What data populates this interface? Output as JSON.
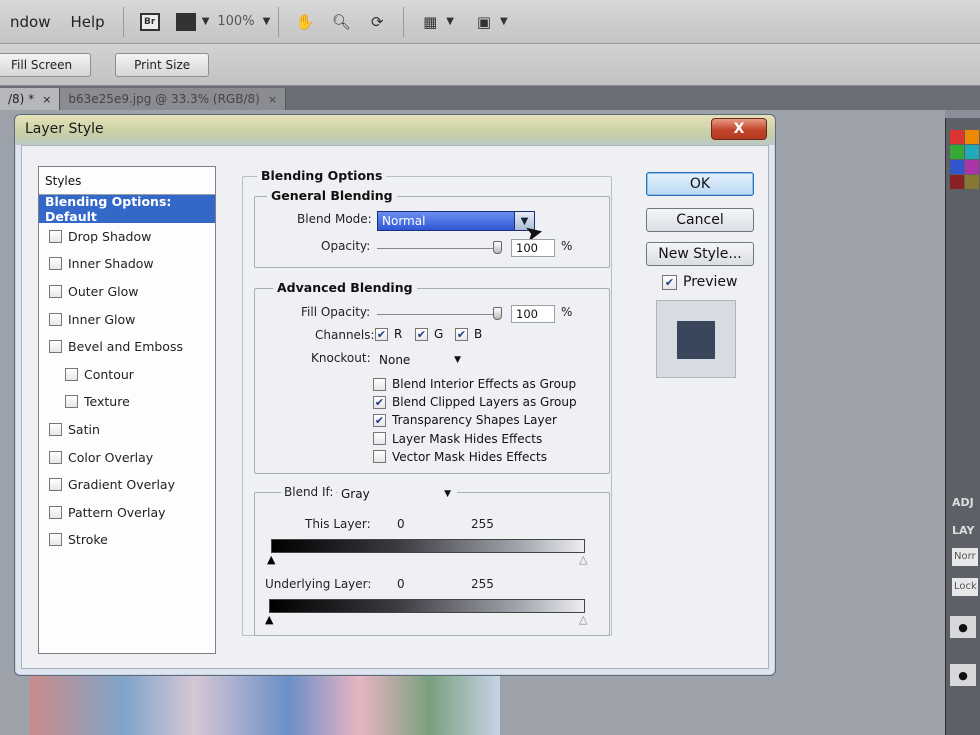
{
  "menubar": {
    "items": [
      "ndow",
      "Help"
    ],
    "zoom_level": "100%"
  },
  "optionsbar": {
    "fill_screen_label": "Fill Screen",
    "print_size_label": "Print Size"
  },
  "tabs": [
    {
      "label": "/8) *",
      "close": "×"
    },
    {
      "label": "b63e25e9.jpg @ 33.3% (RGB/8)",
      "close": "×"
    }
  ],
  "dialog": {
    "title": "Layer Style",
    "close_label": "X",
    "styles_list": {
      "header": "Styles",
      "items": [
        {
          "label": "Blending Options: Default",
          "selected": true,
          "checkbox": false,
          "checked": false
        },
        {
          "label": "Drop Shadow",
          "checkbox": true,
          "checked": false
        },
        {
          "label": "Inner Shadow",
          "checkbox": true,
          "checked": false
        },
        {
          "label": "Outer Glow",
          "checkbox": true,
          "checked": false
        },
        {
          "label": "Inner Glow",
          "checkbox": true,
          "checked": false
        },
        {
          "label": "Bevel and Emboss",
          "checkbox": true,
          "checked": false
        },
        {
          "label": "Contour",
          "checkbox": true,
          "checked": false,
          "sub": true
        },
        {
          "label": "Texture",
          "checkbox": true,
          "checked": false,
          "sub": true
        },
        {
          "label": "Satin",
          "checkbox": true,
          "checked": false
        },
        {
          "label": "Color Overlay",
          "checkbox": true,
          "checked": false
        },
        {
          "label": "Gradient Overlay",
          "checkbox": true,
          "checked": false
        },
        {
          "label": "Pattern Overlay",
          "checkbox": true,
          "checked": false
        },
        {
          "label": "Stroke",
          "checkbox": true,
          "checked": false
        }
      ]
    },
    "blending_options": {
      "title": "Blending Options",
      "general": {
        "title": "General Blending",
        "blend_mode_label": "Blend Mode:",
        "blend_mode_value": "Normal",
        "opacity_label": "Opacity:",
        "opacity_value": "100",
        "opacity_unit": "%"
      },
      "advanced": {
        "title": "Advanced Blending",
        "fill_opacity_label": "Fill Opacity:",
        "fill_opacity_value": "100",
        "fill_opacity_unit": "%",
        "channels_label": "Channels:",
        "channels": [
          {
            "label": "R",
            "checked": true
          },
          {
            "label": "G",
            "checked": true
          },
          {
            "label": "B",
            "checked": true
          }
        ],
        "knockout_label": "Knockout:",
        "knockout_value": "None",
        "options": [
          {
            "label": "Blend Interior Effects as Group",
            "checked": false
          },
          {
            "label": "Blend Clipped Layers as Group",
            "checked": true
          },
          {
            "label": "Transparency Shapes Layer",
            "checked": true
          },
          {
            "label": "Layer Mask Hides Effects",
            "checked": false
          },
          {
            "label": "Vector Mask Hides Effects",
            "checked": false
          }
        ]
      },
      "blend_if": {
        "label": "Blend If:",
        "value": "Gray",
        "this_layer_label": "This Layer:",
        "this_layer_min": "0",
        "this_layer_max": "255",
        "underlying_label": "Underlying Layer:",
        "underlying_min": "0",
        "underlying_max": "255"
      }
    },
    "buttons": {
      "ok": "OK",
      "cancel": "Cancel",
      "new_style": "New Style...",
      "preview_label": "Preview",
      "preview_checked": true
    }
  },
  "right_panel": {
    "tab1": "ADJ",
    "tab2": "LAY",
    "field1": "Norr",
    "field2": "Lock"
  },
  "colors": {
    "selected_row": "#3468c8",
    "blend_select": "#2f57d6",
    "preview_swatch": "#3a465c"
  }
}
